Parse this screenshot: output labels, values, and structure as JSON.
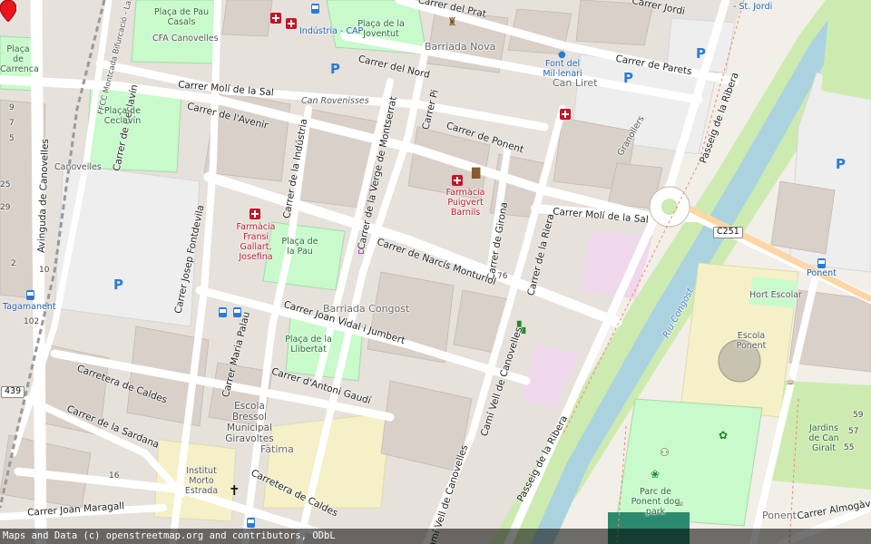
{
  "streets": {
    "prat": "Carrer del Prat",
    "jordi": "Carrer Jordi",
    "sant_jordi": "- St. Jordi",
    "parets": "Carrer de Parets",
    "nord": "Carrer del Nord",
    "moli_sal_top": "Carrer Molí de la Sal",
    "ceclavin": "Carrer de Ceclavín",
    "avenir": "Carrer de l'Avenir",
    "industria": "Carrer de la Indústria",
    "montserrat": "Carrer de la Verge de Montserrat",
    "pi": "Carrer Pi",
    "ponent": "Carrer de Ponent",
    "moli_sal_right": "Carrer Molí de la Sal",
    "girona": "Carrer de Girona",
    "riera": "Carrer de la Riera",
    "monturiol": "Carrer de Narcís Monturiol",
    "fontdevila": "Carrer Josep Fontdevila",
    "vidal": "Carrer Joan Vidal i Jumbert",
    "maria_palau": "Carrer Maria Palau",
    "gaudi": "Carrer d'Antoni Gaudí",
    "caldes_1": "Carretera de Caldes",
    "caldes_2": "Carretera de Caldes",
    "sardana": "Carrer de la Sardana",
    "maragall": "Carrer Joan Maragall",
    "cami_vell_1": "Camí Vell de Canovelles",
    "cami_vell_2": "Camí Vell de Canovelles",
    "passeig_ribera_1": "Passeig de la Ribera",
    "passeig_ribera_2": "Passeig de la Ribera",
    "avinguda": "Avinguda de Canovelles",
    "almogavers": "Carrer Almogàve",
    "ffcc": "FFCC Montcada Bifurcació - La..."
  },
  "places": {
    "barriada_nova": "Barriada Nova",
    "can_liret": "Can Liret",
    "barriada_congost": "Barriada Congost",
    "fatima": "Fàtima",
    "ponent": "Ponent",
    "can_rovenisses": "Can Rovenisses",
    "canovelles": "Canovelles",
    "granollers": "Granollers"
  },
  "pois": {
    "placa_pau_casals": "Plaça de Pau Casals",
    "cfa": "CFA Canovelles",
    "industria_cap": "Indústria - CAP",
    "placa_joventut": "Plaça de la Joventut",
    "font_millenari": "Font del Mil·lenari",
    "placa_ceclavin": "Plaça de Ceclavín",
    "placa_carrenca": "Plaça de Carrenca",
    "farmacia_puigvert": "Farmàcia Puigvert Barnils",
    "farmacia_fransi": "Farmàcia Fransi Gallart, Josefina",
    "placa_pau": "Plaça de la Pau",
    "placa_llibertat": "Plaça de la Llibertat",
    "escola_bressol": "Escola Bressol Municipal Giravoltes",
    "institut": "Institut Morto Estrada",
    "hort_escolar": "Hort Escolar",
    "escola_ponent": "Escola Ponent",
    "jardins_giralt": "Jardins de Can Giralt",
    "parc_ponent": "Parc de Ponent dog park",
    "tagamanent": "Tagamanent",
    "ponent_bus": "Ponent",
    "riu_congost": "Riu Congost"
  },
  "routes": {
    "c251": "C251",
    "r439": "439"
  },
  "house_numbers": {
    "n76": "76",
    "n102": "102",
    "n16": "16",
    "n59": "59",
    "n57": "57",
    "n55": "55",
    "n10": "10",
    "n2": "2",
    "n9": "9",
    "n7": "7",
    "n5": "5",
    "n25": "25",
    "n29": "29"
  },
  "icons": [
    "pharmacy-icon",
    "bus-stop-icon",
    "parking-icon",
    "library-icon",
    "shop-icon",
    "church-icon",
    "playground-icon",
    "dog-park-icon",
    "drinking-water-icon",
    "game-icon",
    "map-marker-icon"
  ],
  "colors": {
    "background": "#f2efe9",
    "building": "#d9d0c9",
    "road": "#ffffff",
    "park": "#c8facc",
    "grass": "#cdebb0",
    "river": "#aad3df",
    "pharmacy": "#c0162a",
    "parking": "#2a7bd4",
    "marker": "#e8141e"
  },
  "attribution": "Maps and Data (c) openstreetmap.org and contributors, ODbL"
}
